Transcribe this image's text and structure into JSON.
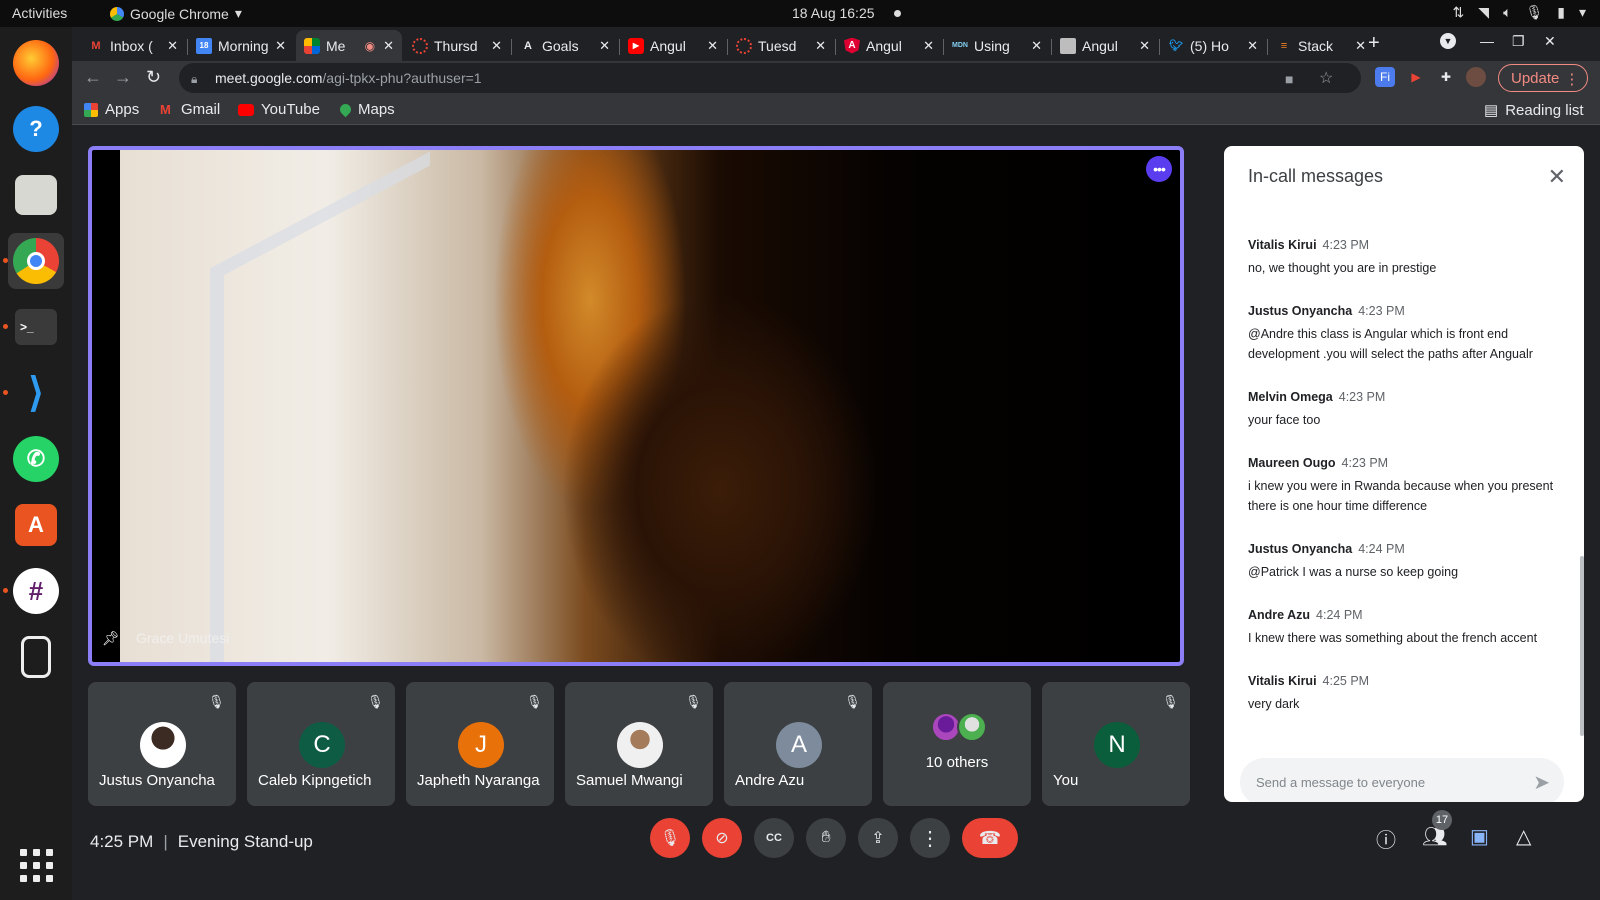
{
  "topbar": {
    "activities": "Activities",
    "app_name": "Google Chrome",
    "app_menu_icon": "triangle-down",
    "datetime": "18 Aug  16:25"
  },
  "dock": {
    "items": [
      "firefox",
      "help",
      "files",
      "chrome",
      "terminal",
      "vscode",
      "whatsapp",
      "software-center",
      "slack",
      "media-player"
    ]
  },
  "tabs": [
    {
      "label": "Inbox (",
      "favicon": "gmail"
    },
    {
      "label": "Morning",
      "favicon": "calendar"
    },
    {
      "label": "Me",
      "favicon": "meet"
    },
    {
      "label": "Thursd",
      "favicon": "spinner"
    },
    {
      "label": "Goals",
      "favicon": "angular-a"
    },
    {
      "label": "Angul",
      "favicon": "youtube"
    },
    {
      "label": "Tuesd",
      "favicon": "spinner"
    },
    {
      "label": "Angul",
      "favicon": "angular"
    },
    {
      "label": "Using",
      "favicon": "mdn"
    },
    {
      "label": "Angul",
      "favicon": "image"
    },
    {
      "label": "(5) Ho",
      "favicon": "twitter"
    },
    {
      "label": "Stack",
      "favicon": "stackoverflow"
    }
  ],
  "omnibox": {
    "host": "meet.google.com",
    "path": "/agi-tpkx-phu?authuser=1"
  },
  "update_label": "Update",
  "bookmarks": [
    {
      "label": "Apps"
    },
    {
      "label": "Gmail"
    },
    {
      "label": "YouTube"
    },
    {
      "label": "Maps"
    }
  ],
  "reading_list": "Reading list",
  "main_video": {
    "participant": "Grace Umutesi"
  },
  "tiles": [
    {
      "name": "Justus Onyancha",
      "initial": "",
      "color": "#ffffff"
    },
    {
      "name": "Caleb Kipngetich",
      "initial": "C",
      "color": "#0f5c45"
    },
    {
      "name": "Japheth Nyaranga",
      "initial": "J",
      "color": "#e8710a"
    },
    {
      "name": "Samuel Mwangi",
      "initial": "",
      "color": "#f0f0f0"
    },
    {
      "name": "Andre Azu",
      "initial": "A",
      "color": "#7d8b9c"
    },
    {
      "name": "10 others",
      "initial": "",
      "color": "#3c4043"
    },
    {
      "name": "You",
      "initial": "N",
      "color": "#0b5e3b"
    }
  ],
  "chat": {
    "title": "In-call messages",
    "messages": [
      {
        "sender": "Vitalis Kirui",
        "time": "4:23 PM",
        "text": "no, we thought you are in prestige"
      },
      {
        "sender": "Justus Onyancha",
        "time": "4:23 PM",
        "text": "@Andre this class is Angular which is front end development .you will select the paths after Angualr"
      },
      {
        "sender": "Melvin Omega",
        "time": "4:23 PM",
        "text": "your face too"
      },
      {
        "sender": "Maureen Ougo",
        "time": "4:23 PM",
        "text": "i knew you were in Rwanda because when you present there is one hour time difference"
      },
      {
        "sender": "Justus Onyancha",
        "time": "4:24 PM",
        "text": "@Patrick I was a nurse so keep going"
      },
      {
        "sender": "Andre Azu",
        "time": "4:24 PM",
        "text": "I knew there was something about the french accent"
      },
      {
        "sender": "Vitalis Kirui",
        "time": "4:25 PM",
        "text": "very dark"
      }
    ],
    "composer_placeholder": "Send a message to everyone"
  },
  "bottom": {
    "time": "4:25 PM",
    "meeting_name": "Evening Stand-up",
    "participant_count": "17"
  },
  "colors": {
    "accent_border": "#8b7ef6",
    "danger": "#ea4335",
    "panel_bg": "#202124"
  }
}
